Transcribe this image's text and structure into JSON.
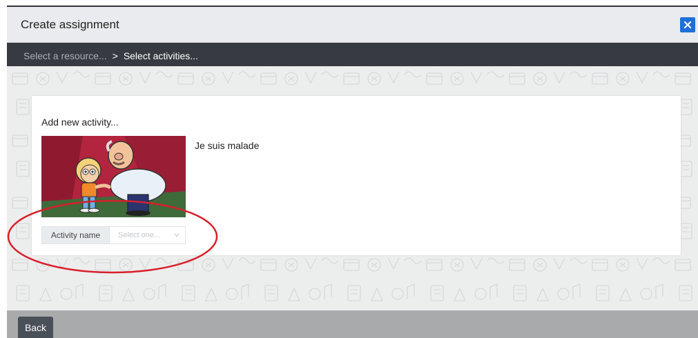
{
  "modal": {
    "title": "Create assignment",
    "close_icon": "close-icon"
  },
  "breadcrumb": {
    "step1": "Select a resource...",
    "separator": ">",
    "step2": "Select activities..."
  },
  "card": {
    "add_label": "Add new activity...",
    "activity_title": "Je suis malade",
    "select_label": "Activity name",
    "select_placeholder": "Select one...",
    "select_icon": "chevron-down-icon"
  },
  "footer": {
    "back_label": "Back"
  },
  "colors": {
    "accent": "#1e6fd9",
    "breadcrumb_bg": "#373b41",
    "annotation": "#d81f2a"
  }
}
